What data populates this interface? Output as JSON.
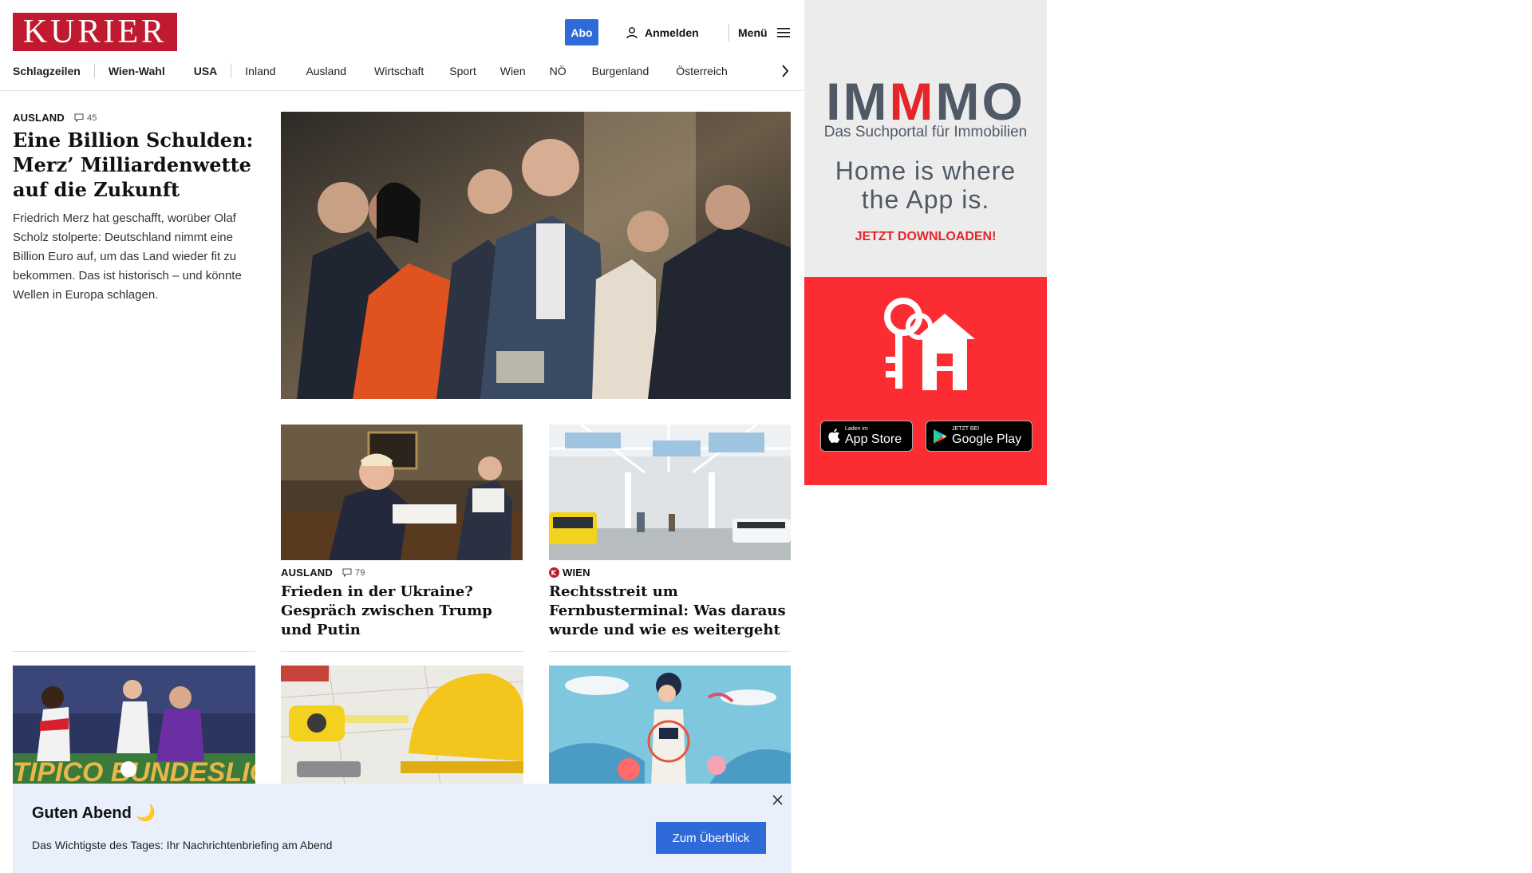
{
  "header": {
    "logo": "KURIER",
    "abo_label": "Abo",
    "login_label": "Anmelden",
    "menu_label": "Menü",
    "icons": {
      "login": "user-icon",
      "menu": "hamburger-icon",
      "nav_next": "chevron-right-icon"
    }
  },
  "nav": {
    "items": [
      "Schlagzeilen",
      "Wien-Wahl",
      "USA",
      "Inland",
      "Ausland",
      "Wirtschaft",
      "Sport",
      "Wien",
      "NÖ",
      "Burgenland",
      "Österreich"
    ]
  },
  "lead": {
    "kicker": "AUSLAND",
    "comments": "45",
    "title": "Eine Billion Schulden: Merz’ Milliardenwette auf die Zukunft",
    "teaser": "Friedrich Merz hat geschafft, worüber Olaf Scholz stolperte: Deutschland nimmt eine Billion Euro auf, um das Land wieder fit zu bekommen. Das ist historisch – und könnte Wellen in Europa schlagen."
  },
  "cards": [
    {
      "kicker": "AUSLAND",
      "comments": "79",
      "title": "Frieden in der Ukraine? Gespräch zwischen Trump und Putin"
    },
    {
      "kicker": "WIEN",
      "title": "Rechtsstreit um Fernbusterminal: Was daraus wurde und wie es weitergeht"
    }
  ],
  "bottom_images": {
    "first_banner_text": "TIPICO BUNDESLIGA"
  },
  "ad": {
    "brand_pre": "IM",
    "brand_accent": "M",
    "brand_post": "MO",
    "tagline": "Das Suchportal für Immobilien",
    "headline_1": "Home is where",
    "headline_2": "the App is.",
    "cta": "JETZT DOWNLOADEN!",
    "appstore_small": "Laden im",
    "appstore_big": "App Store",
    "gplay_small": "JETZT BEI",
    "gplay_big": "Google Play",
    "colors": {
      "accent": "#e4262b",
      "panel": "#fb2d33",
      "text": "#505a66"
    }
  },
  "greeting": {
    "title": "Guten Abend 🌙",
    "text": "Das Wichtigste des Tages: Ihr Nachrichtenbriefing am Abend",
    "button": "Zum Überblick"
  },
  "colors": {
    "brand": "#bf1a2f",
    "button": "#2f6bd8",
    "greeting_bg": "#e9f0fb"
  }
}
